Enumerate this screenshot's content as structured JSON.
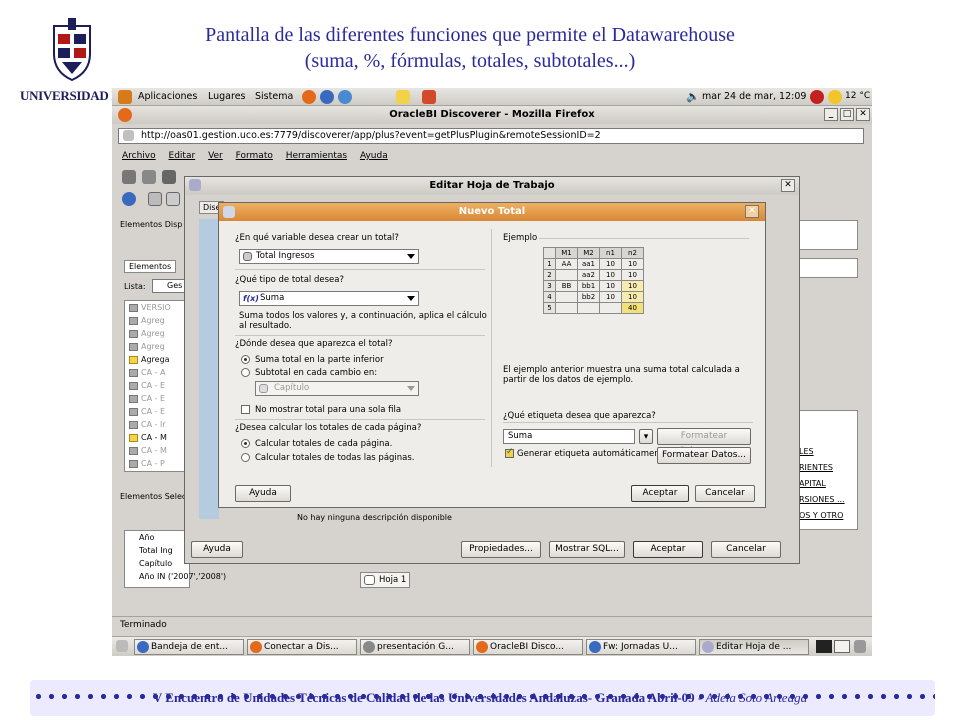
{
  "slide": {
    "title_line1": "Pantalla de las diferentes funciones que permite el Datawarehouse",
    "title_line2": "(suma, %, fórmulas, totales, subtotales...)",
    "logo_text": "UNIVERSIDAD D CORD",
    "footer_main": "V Encuentro de Unidades Técnicas de Calidad de las Universidades Andaluzas- Granada Abril-09 - ",
    "footer_author": "Adela Soto Arteaga"
  },
  "desktop": {
    "menu": [
      "Aplicaciones",
      "Lugares",
      "Sistema"
    ],
    "clock": "mar 24 de mar, 12:09",
    "temperature": "12 °C"
  },
  "browser": {
    "title": "OracleBI Discoverer - Mozilla Firefox",
    "url": "http://oas01.gestion.uco.es:7779/discoverer/app/plus?event=getPlusPlugin&remoteSessionID=2",
    "menu": [
      "Archivo",
      "Editar",
      "Ver",
      "Formato",
      "Herramientas",
      "Ayuda"
    ],
    "status": "Terminado"
  },
  "discoverer": {
    "elements_available_label": "Elementos Disp",
    "elements_tab": "Elementos",
    "list_label": "Lista:",
    "list_value": "Ges",
    "tree_items": [
      {
        "label": "VERSIO",
        "dark": false
      },
      {
        "label": "Agreg",
        "dark": false
      },
      {
        "label": "Agreg",
        "dark": false
      },
      {
        "label": "Agreg",
        "dark": false
      },
      {
        "label": "Agrega",
        "dark": true
      },
      {
        "label": "CA - A",
        "dark": false
      },
      {
        "label": "CA - E",
        "dark": false
      },
      {
        "label": "CA - E",
        "dark": false
      },
      {
        "label": "CA - E",
        "dark": false
      },
      {
        "label": "CA - Ir",
        "dark": false
      },
      {
        "label": "CA - M",
        "dark": true
      },
      {
        "label": "CA - M",
        "dark": false
      },
      {
        "label": "CA - P",
        "dark": false
      }
    ],
    "selected_label": "Elementos Selec",
    "selected_items": [
      "Año",
      "Total Ing",
      "Capítulo",
      "Año IN ('2007','2008')"
    ],
    "right_links": [
      "LES",
      "RIENTES",
      "APITAL",
      "RSIONES ...",
      "OS Y OTRO"
    ],
    "no_description": "No hay ninguna descripción disponible",
    "sheet_tab": "Hoja 1"
  },
  "edit_sheet": {
    "title": "Editar Hoja de Trabajo",
    "tab_partial": "Dise",
    "help_button": "Ayuda",
    "properties_button": "Propiedades...",
    "show_sql_button": "Mostrar SQL...",
    "accept_button": "Aceptar",
    "cancel_button": "Cancelar"
  },
  "new_total": {
    "title": "Nuevo Total",
    "q_variable": "¿En qué variable desea crear un total?",
    "variable_value": "Total Ingresos",
    "q_type": "¿Qué tipo de total desea?",
    "type_value": "Suma",
    "type_desc": "Suma todos los valores y, a continuación, aplica el cálculo al resultado.",
    "q_where": "¿Dónde desea que aparezca el total?",
    "opt_bottom": "Suma total en la parte inferior",
    "opt_subtotal": "Subtotal en cada cambio en:",
    "subtotal_value": "Capítulo",
    "no_show_single": "No mostrar total para una sola fila",
    "q_page": "¿Desea calcular los totales de cada página?",
    "opt_each_page": "Calcular totales de cada página.",
    "opt_all_pages": "Calcular totales de todas las páginas.",
    "example_label": "Ejemplo",
    "example_headers": [
      "",
      "M1",
      "M2",
      "n1",
      "n2"
    ],
    "example_rows": [
      [
        "1",
        "AA",
        "aa1",
        "10",
        "10"
      ],
      [
        "2",
        "",
        "aa2",
        "10",
        "10"
      ],
      [
        "3",
        "BB",
        "bb1",
        "10",
        "10"
      ],
      [
        "4",
        "",
        "bb2",
        "10",
        "10"
      ],
      [
        "5",
        "",
        "",
        "",
        "40"
      ]
    ],
    "example_desc": "El ejemplo anterior muestra una suma total calculada a partir de los datos de ejemplo.",
    "q_label": "¿Qué etiqueta desea que aparezca?",
    "label_value": "Suma",
    "format_header_button": "Formatear Cabecera...",
    "auto_label": "Generar etiqueta automáticamente",
    "format_data_button": "Formatear Datos...",
    "help_button": "Ayuda",
    "accept_button": "Aceptar",
    "cancel_button": "Cancelar"
  },
  "taskbar": [
    "Bandeja de ent...",
    "Conectar a Dis...",
    "presentación G...",
    "OracleBI Disco...",
    "Fw: Jornadas U...",
    "Editar Hoja de ..."
  ],
  "colors": {
    "slide_title": "#2a2a9a",
    "dialog_title_bar": "#e8a050",
    "highlight_total": "#f2e07a"
  }
}
